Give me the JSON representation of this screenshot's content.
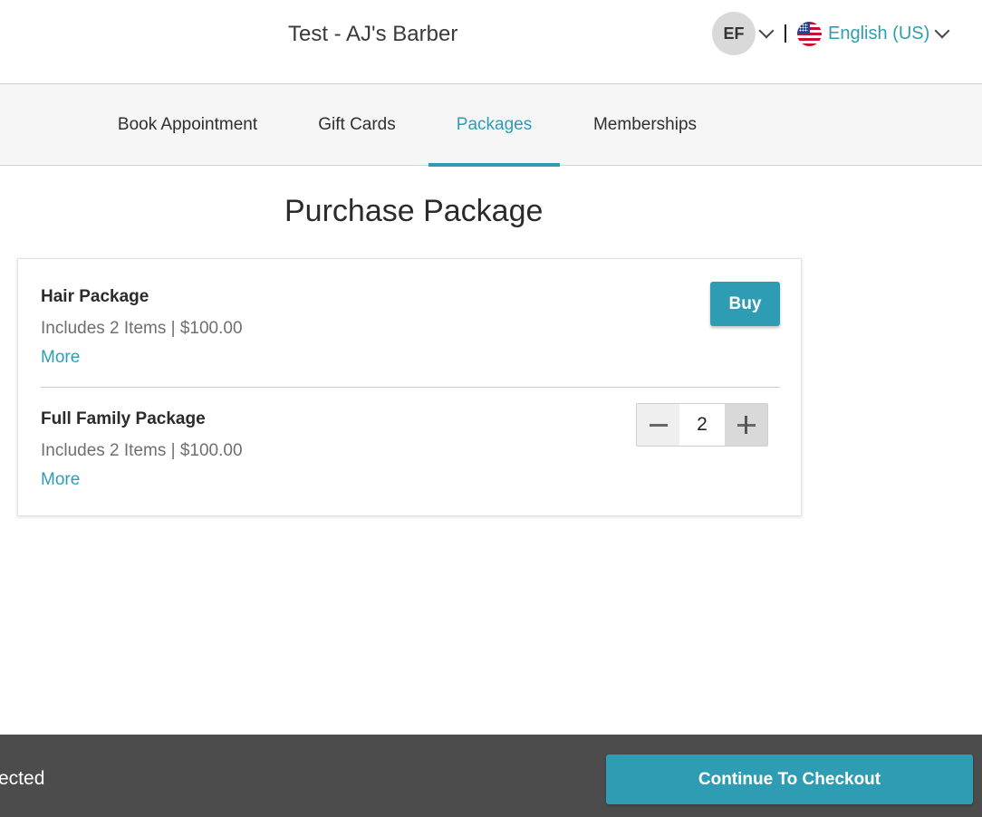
{
  "header": {
    "store_title": "Test - AJ's Barber",
    "user_initials": "EF",
    "language": "English (US)"
  },
  "tabs": [
    {
      "label": "Book Appointment",
      "active": false
    },
    {
      "label": "Gift Cards",
      "active": false
    },
    {
      "label": "Packages",
      "active": true
    },
    {
      "label": "Memberships",
      "active": false
    }
  ],
  "main": {
    "heading": "Purchase Package",
    "packages": [
      {
        "name": "Hair Package",
        "meta": "Includes 2 Items | $100.00",
        "more": "More",
        "action": "Buy"
      },
      {
        "name": "Full Family Package",
        "meta": "Includes 2 Items | $100.00",
        "more": "More",
        "quantity": "2"
      }
    ]
  },
  "footer": {
    "selected_text": "ected",
    "checkout_label": "Continue To Checkout"
  },
  "colors": {
    "accent": "#2e9db3",
    "footer_bg": "#4c4c4c"
  },
  "icons": [
    "chevron-down-icon",
    "us-flag-icon",
    "minus-icon",
    "plus-icon"
  ]
}
